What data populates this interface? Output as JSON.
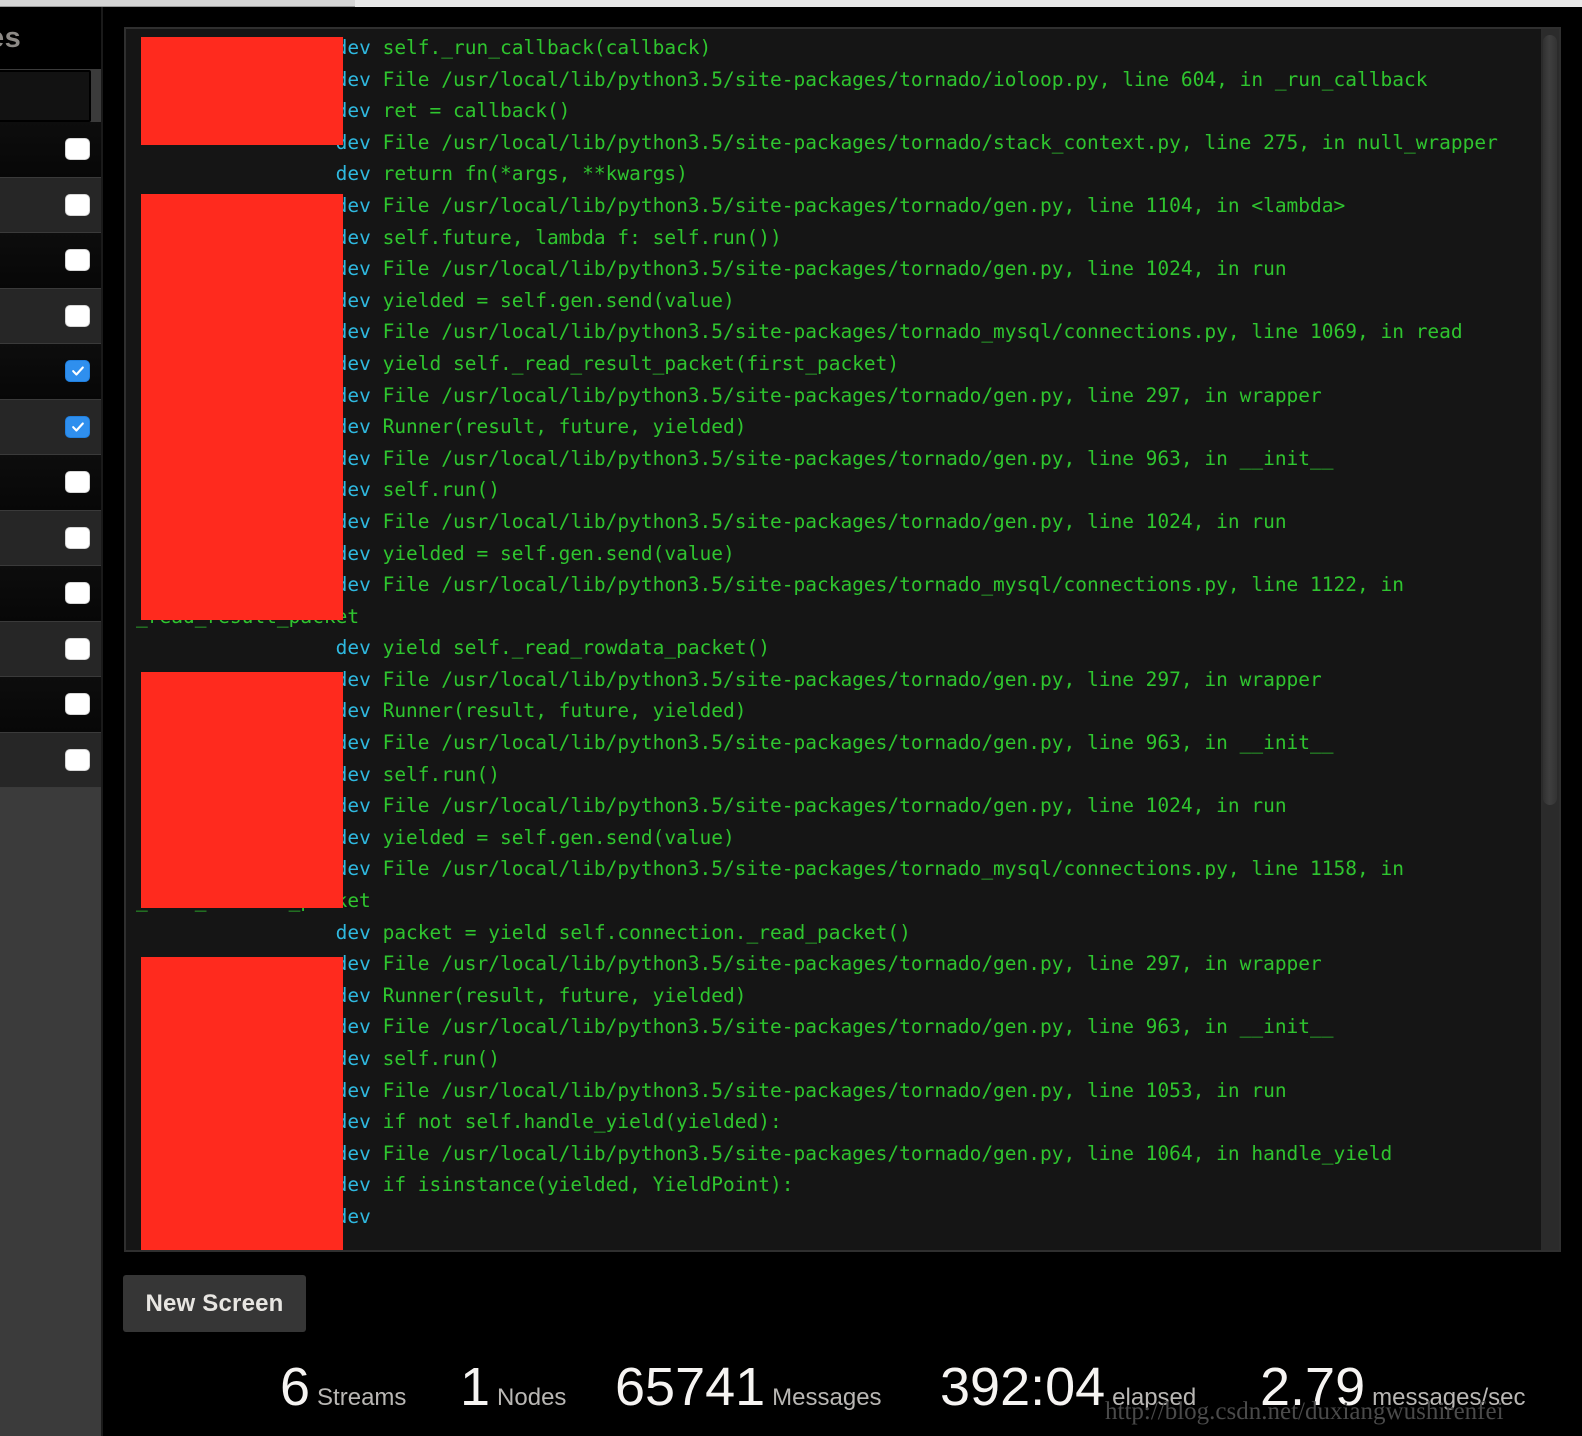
{
  "sidebar": {
    "header_title": "es",
    "search": {
      "value": "",
      "placeholder": ""
    },
    "rows": [
      {
        "label": "",
        "checked": false
      },
      {
        "label": "",
        "checked": false
      },
      {
        "label": "",
        "checked": false
      },
      {
        "label": "",
        "checked": false
      },
      {
        "label": "",
        "checked": true
      },
      {
        "label": "",
        "checked": true
      },
      {
        "label": "",
        "checked": false
      },
      {
        "label": "",
        "checked": false
      },
      {
        "label": "",
        "checked": false
      },
      {
        "label": "",
        "checked": false
      },
      {
        "label": "",
        "checked": false
      },
      {
        "label": "",
        "checked": false
      }
    ]
  },
  "log": {
    "source_label": "dev",
    "lines": [
      "self._run_callback(callback)",
      "File /usr/local/lib/python3.5/site-packages/tornado/ioloop.py, line 604, in _run_callback",
      "ret = callback()",
      "File /usr/local/lib/python3.5/site-packages/tornado/stack_context.py, line 275, in null_wrapper",
      "return fn(*args, **kwargs)",
      "File /usr/local/lib/python3.5/site-packages/tornado/gen.py, line 1104, in <lambda>",
      "self.future, lambda f: self.run())",
      "File /usr/local/lib/python3.5/site-packages/tornado/gen.py, line 1024, in run",
      "yielded = self.gen.send(value)",
      "File /usr/local/lib/python3.5/site-packages/tornado_mysql/connections.py, line 1069, in read",
      "yield self._read_result_packet(first_packet)",
      "File /usr/local/lib/python3.5/site-packages/tornado/gen.py, line 297, in wrapper",
      "Runner(result, future, yielded)",
      "File /usr/local/lib/python3.5/site-packages/tornado/gen.py, line 963, in __init__",
      "self.run()",
      "File /usr/local/lib/python3.5/site-packages/tornado/gen.py, line 1024, in run",
      "yielded = self.gen.send(value)",
      "File /usr/local/lib/python3.5/site-packages/tornado_mysql/connections.py, line 1122, in _read_result_packet",
      "yield self._read_rowdata_packet()",
      "File /usr/local/lib/python3.5/site-packages/tornado/gen.py, line 297, in wrapper",
      "Runner(result, future, yielded)",
      "File /usr/local/lib/python3.5/site-packages/tornado/gen.py, line 963, in __init__",
      "self.run()",
      "File /usr/local/lib/python3.5/site-packages/tornado/gen.py, line 1024, in run",
      "yielded = self.gen.send(value)",
      "File /usr/local/lib/python3.5/site-packages/tornado_mysql/connections.py, line 1158, in _read_rowdata_packet",
      "packet = yield self.connection._read_packet()",
      "File /usr/local/lib/python3.5/site-packages/tornado/gen.py, line 297, in wrapper",
      "Runner(result, future, yielded)",
      "File /usr/local/lib/python3.5/site-packages/tornado/gen.py, line 963, in __init__",
      "self.run()",
      "File /usr/local/lib/python3.5/site-packages/tornado/gen.py, line 1053, in run",
      "if not self.handle_yield(yielded):",
      "File /usr/local/lib/python3.5/site-packages/tornado/gen.py, line 1064, in handle_yield",
      "if isinstance(yielded, YieldPoint):",
      ""
    ],
    "colors": {
      "text": "#2fc52f",
      "source": "#2fb9e0",
      "background": "#151515",
      "redaction": "#ff2a1e"
    }
  },
  "buttons": {
    "new_screen": "New Screen"
  },
  "statusbar": {
    "streams": {
      "value": "6",
      "label": "Streams"
    },
    "nodes": {
      "value": "1",
      "label": "Nodes"
    },
    "messages": {
      "value": "65741",
      "label": "Messages"
    },
    "elapsed": {
      "value": "392:04",
      "label": "elapsed"
    },
    "rate": {
      "value": "2.79",
      "label": "messages/sec"
    }
  },
  "watermark": "http://blog.csdn.net/duxiangwushirenfei"
}
